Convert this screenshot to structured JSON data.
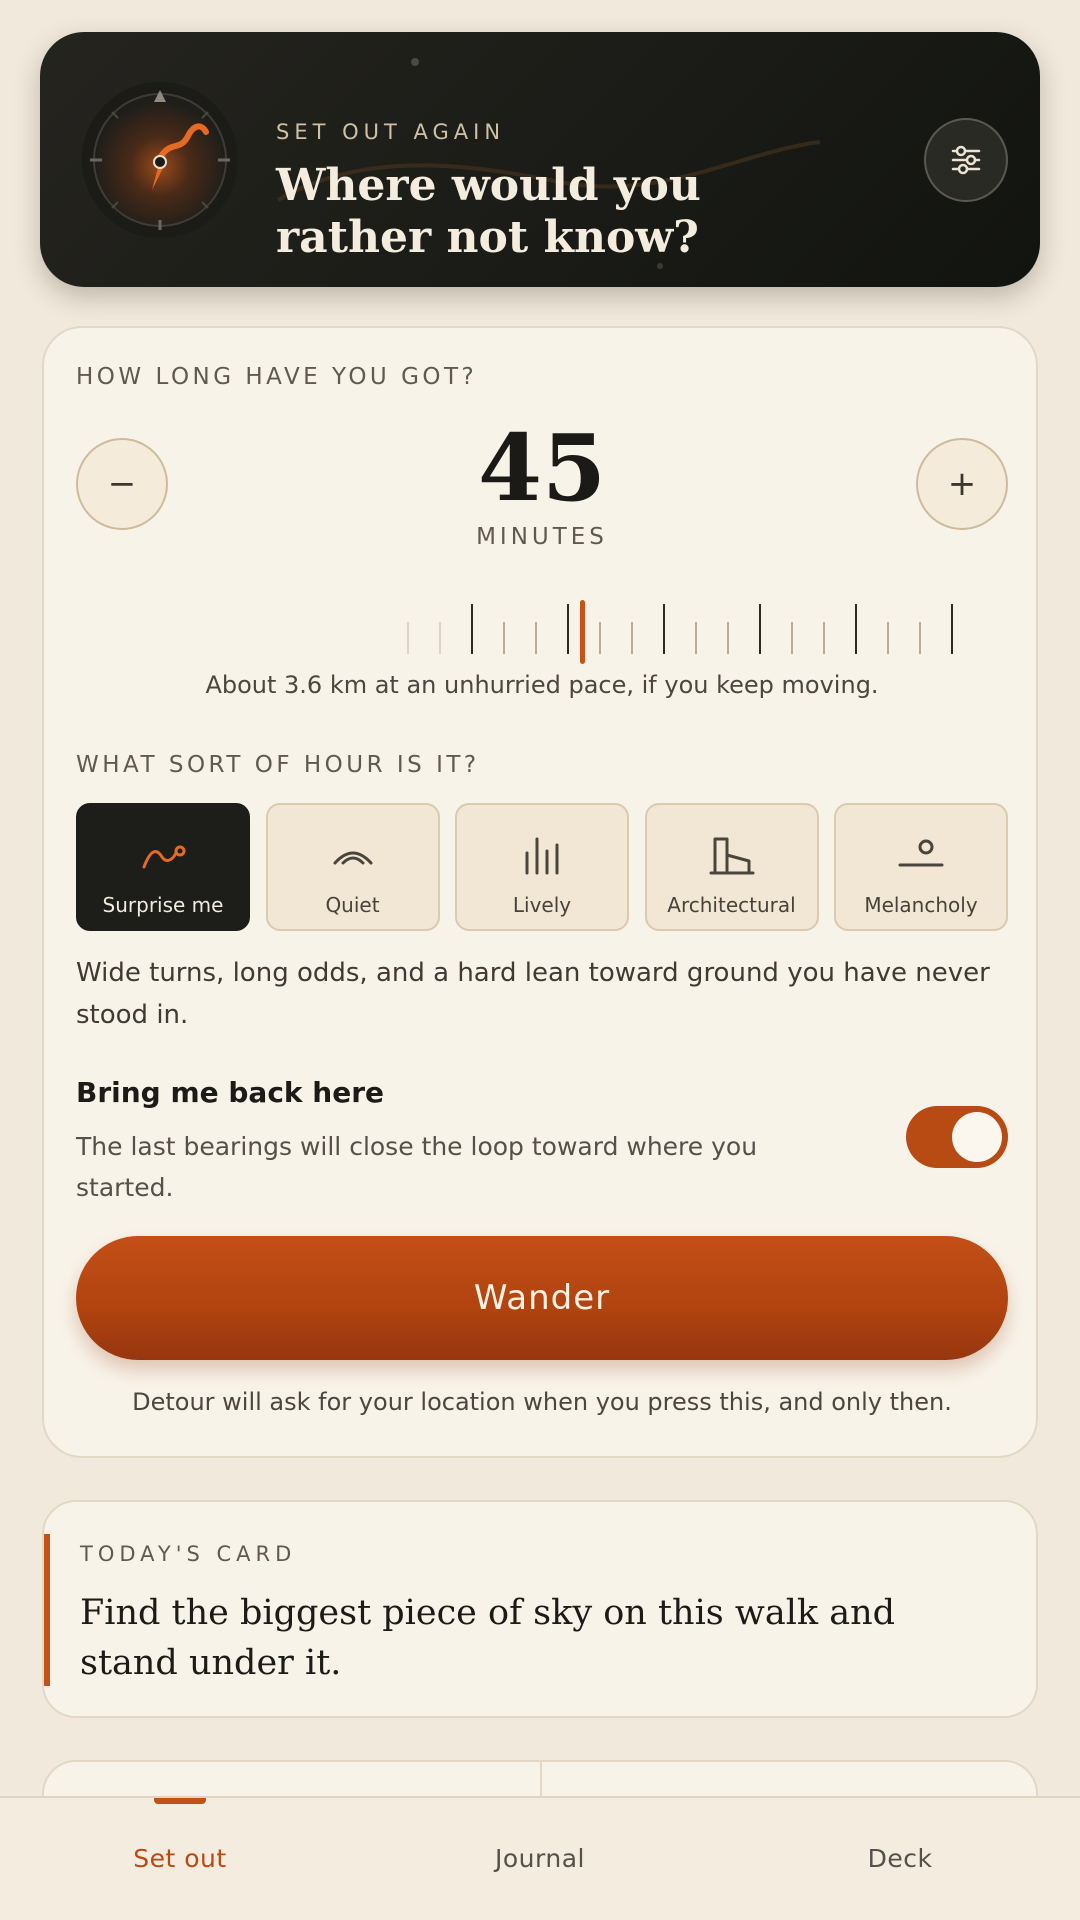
{
  "header": {
    "eyebrow": "SET OUT AGAIN",
    "title": "Where would you rather not know?",
    "settings_icon": "sliders-icon"
  },
  "duration": {
    "label": "HOW LONG HAVE YOU GOT?",
    "minus_label": "−",
    "plus_label": "+",
    "value": "45",
    "unit": "MINUTES",
    "pace_text": "About 3.6 km at an unhurried pace, if you keep moving."
  },
  "hour": {
    "label": "WHAT SORT OF HOUR IS IT?",
    "options": [
      {
        "label": "Surprise me",
        "icon": "curve-path-icon",
        "active": true
      },
      {
        "label": "Quiet",
        "icon": "arc-icon",
        "active": false
      },
      {
        "label": "Lively",
        "icon": "bars-icon",
        "active": false
      },
      {
        "label": "Architectural",
        "icon": "building-icon",
        "active": false
      },
      {
        "label": "Melancholy",
        "icon": "horizon-icon",
        "active": false
      }
    ],
    "description": "Wide turns, long odds, and a hard lean toward ground you have never stood in."
  },
  "return_loop": {
    "title": "Bring me back here",
    "description": "The last bearings will close the loop toward where you started.",
    "enabled": true
  },
  "action": {
    "wander_label": "Wander",
    "location_note": "Detour will ask for your location when you press this, and only then."
  },
  "today_card": {
    "label": "TODAY'S CARD",
    "text": "Find the biggest piece of sky on this walk and stand under it."
  },
  "nav": {
    "items": [
      {
        "label": "Set out",
        "active": true
      },
      {
        "label": "Journal",
        "active": false
      },
      {
        "label": "Deck",
        "active": false
      }
    ]
  },
  "colors": {
    "accent": "#b84a14",
    "dark": "#1d1d19",
    "background": "#f1e9dc"
  }
}
